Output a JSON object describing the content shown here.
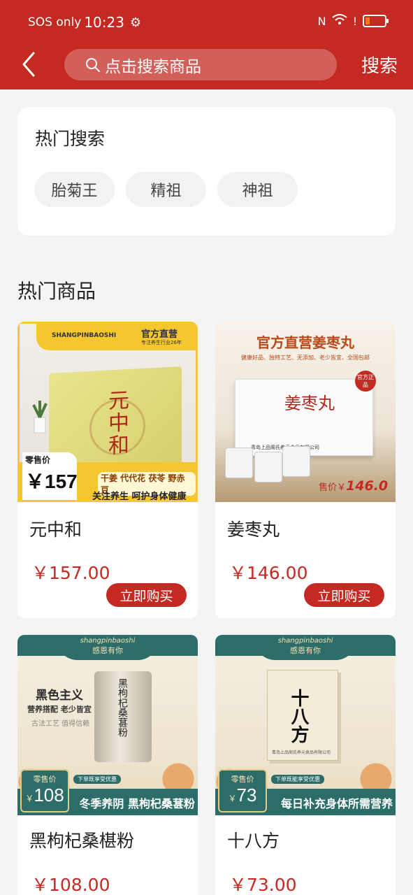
{
  "status_bar": {
    "carrier": "SOS only",
    "time": "10:23"
  },
  "header": {
    "search_placeholder": "点击搜索商品",
    "search_button": "搜索"
  },
  "hot_search": {
    "title": "热门搜索",
    "chips": [
      "胎菊王",
      "精祖",
      "神祖"
    ]
  },
  "hot_products": {
    "title": "热门商品",
    "buy_label": "立即购买",
    "items": [
      {
        "name": "元中和",
        "price": "￥157.00",
        "image": {
          "brand": "SHANGPINBAOSHI",
          "badge": "官方直营",
          "badge_sub": "专注养生行业26年",
          "product_text": "元中和",
          "retail_label": "零售价",
          "retail_price": "￥157",
          "herbs": "干姜 代代花 茯苓 野赤豆",
          "slogan": "关注养生 呵护身体健康"
        }
      },
      {
        "name": "姜枣丸",
        "price": "￥146.00",
        "image": {
          "headline": "官方直营姜枣丸",
          "subline": "健康好品、独特工艺、无添加、老少皆宜、全国包邮",
          "product_text": "姜枣丸",
          "company": "青岛上品阁氏养元食品有限公司",
          "badge": "官方正品",
          "price_label": "售价￥",
          "price_value": "146.0"
        }
      },
      {
        "name": "黑枸杞桑椹粉",
        "price": "￥108.00",
        "image": {
          "brand": "shangpinbaoshi",
          "motto": "感恩有你",
          "headline": "黑色主义",
          "sub1": "营养搭配 老少皆宜",
          "sub2": "古法工艺 值得信赖",
          "can_text": "黑枸杞桑葚粉",
          "retail_label": "零售价",
          "retail_currency": "￥",
          "retail_price": "108",
          "promo": "下单既享受优惠",
          "slogan": "冬季养阴 黑枸杞桑葚粉"
        }
      },
      {
        "name": "十八方",
        "price": "￥73.00",
        "image": {
          "brand": "shangpinbaoshi",
          "motto": "感恩有你",
          "pkg_text": "十八方",
          "company": "青岛上品阁氏养元食品有限公司",
          "retail_label": "零售价",
          "retail_currency": "￥",
          "retail_price": "73",
          "promo": "下单既能享受优惠",
          "slogan": "每日补充身体所需营养"
        }
      }
    ]
  },
  "colors": {
    "brand_red": "#c42a22",
    "teal": "#2c6d6a",
    "gold": "#f5c72f"
  }
}
